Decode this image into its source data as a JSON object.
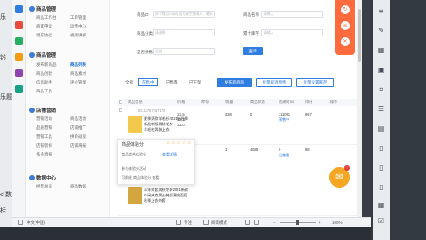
{
  "left_fragments": [
    "乐",
    "钱",
    "乐题评",
    "< 数}",
    "标"
  ],
  "nav": {
    "groups": [
      {
        "title": "商品管理",
        "items": [
          "商品工作台",
          "工单管理",
          "商家申诉",
          "运营中心",
          "退店协议",
          "视频讲解"
        ]
      },
      {
        "title": "商品管理",
        "items": [
          "发布新商品",
          "商品列表",
          "商品创建",
          "商品素材",
          "信息助手",
          "评价管理",
          "商品工具"
        ]
      },
      {
        "title": "店铺营销",
        "items": [
          "营销活动",
          "商品活动",
          "品质营销",
          "店铺推广",
          "营销工具",
          "拼单返现",
          "店铺装修",
          "店铺海报",
          "多多直播"
        ]
      },
      {
        "title": "数据中心",
        "items": [
          "经营总览",
          "商品数据"
        ]
      }
    ]
  },
  "filters": {
    "name_label": "商品ID",
    "name_placeholder": "多个商品ID请用逗号或空格隔开，最多",
    "cat_label": "商品名称",
    "cat_placeholder": "请输入",
    "sku_label": "商品分类",
    "sku_placeholder": "请选择",
    "spec_label": "累计库存",
    "spec_placeholder": "请输入",
    "price_label": "是否预售",
    "price_placeholder": "全部",
    "search_button": "查询"
  },
  "tabs": [
    "全部",
    "在售中",
    "已售罄",
    "已下架"
  ],
  "toolbar": {
    "publish": "发布新商品",
    "batch_cancel": "批量取消预售",
    "batch_set": "批量设置库存"
  },
  "table": {
    "headers": [
      "商品信息",
      "价格",
      "库存",
      "销量",
      "商品状态",
      "创建时间",
      "排序",
      "操作"
    ],
    "rows": [
      {
        "id": "ID:13767267170",
        "title": [
          "夏季男款羊毛衫2021年秋季",
          "新品韩版男装毛衣",
          "羊毛衫男装上衣"
        ],
        "price": [
          "11.5",
          "12.2",
          "11.0"
        ],
        "stock": "438",
        "sales": "0",
        "status": "111091",
        "extra": "预售中",
        "op": "967"
      },
      {
        "id": "ID:13702394219",
        "title": [
          "夏季男款羊毛衫批发秋冬",
          "男装毛衣2021新款纯色",
          "男士羊毛衫"
        ],
        "price": [
          "15.8",
          "16.0",
          "16.5"
        ],
        "stock": "1",
        "sales": "4888",
        "status": "0",
        "extra": "已售罄",
        "op": "98"
      },
      {
        "id": "ID:13702364215",
        "title": [
          "半年外套男秋冬季2021新款",
          "休闲夹克男士韩版潮流百搭",
          "秋季上衣外套"
        ],
        "price": [
          "",
          "",
          ""
        ],
        "stock": "",
        "sales": "",
        "status": "",
        "extra": "",
        "op": ""
      }
    ]
  },
  "popup": {
    "title": "商品体验分",
    "lines": [
      "商品综合体验分",
      "查看详情",
      "参与体验分活动",
      "可前往 商品体验分 查看"
    ]
  },
  "statusbar": {
    "left": "中文(中国)",
    "middle": "专注",
    "zoom": "100%",
    "mode": "阅读模式"
  },
  "colors": {
    "accent": "#2f7de1",
    "float_panel": "#ff6b3d",
    "mail": "#f5a623",
    "badge": "#e53935"
  },
  "icons": {
    "float": [
      "refresh-icon",
      "note-icon",
      "close-icon"
    ],
    "right_toolbar": [
      "menu-icon",
      "brush-icon",
      "table-icon",
      "image-icon",
      "crop-icon",
      "list-icon",
      "note-icon",
      "doc-icon",
      "doc-icon",
      "doc-icon",
      "calendar-icon",
      "checklist-icon",
      "shield-icon"
    ]
  }
}
